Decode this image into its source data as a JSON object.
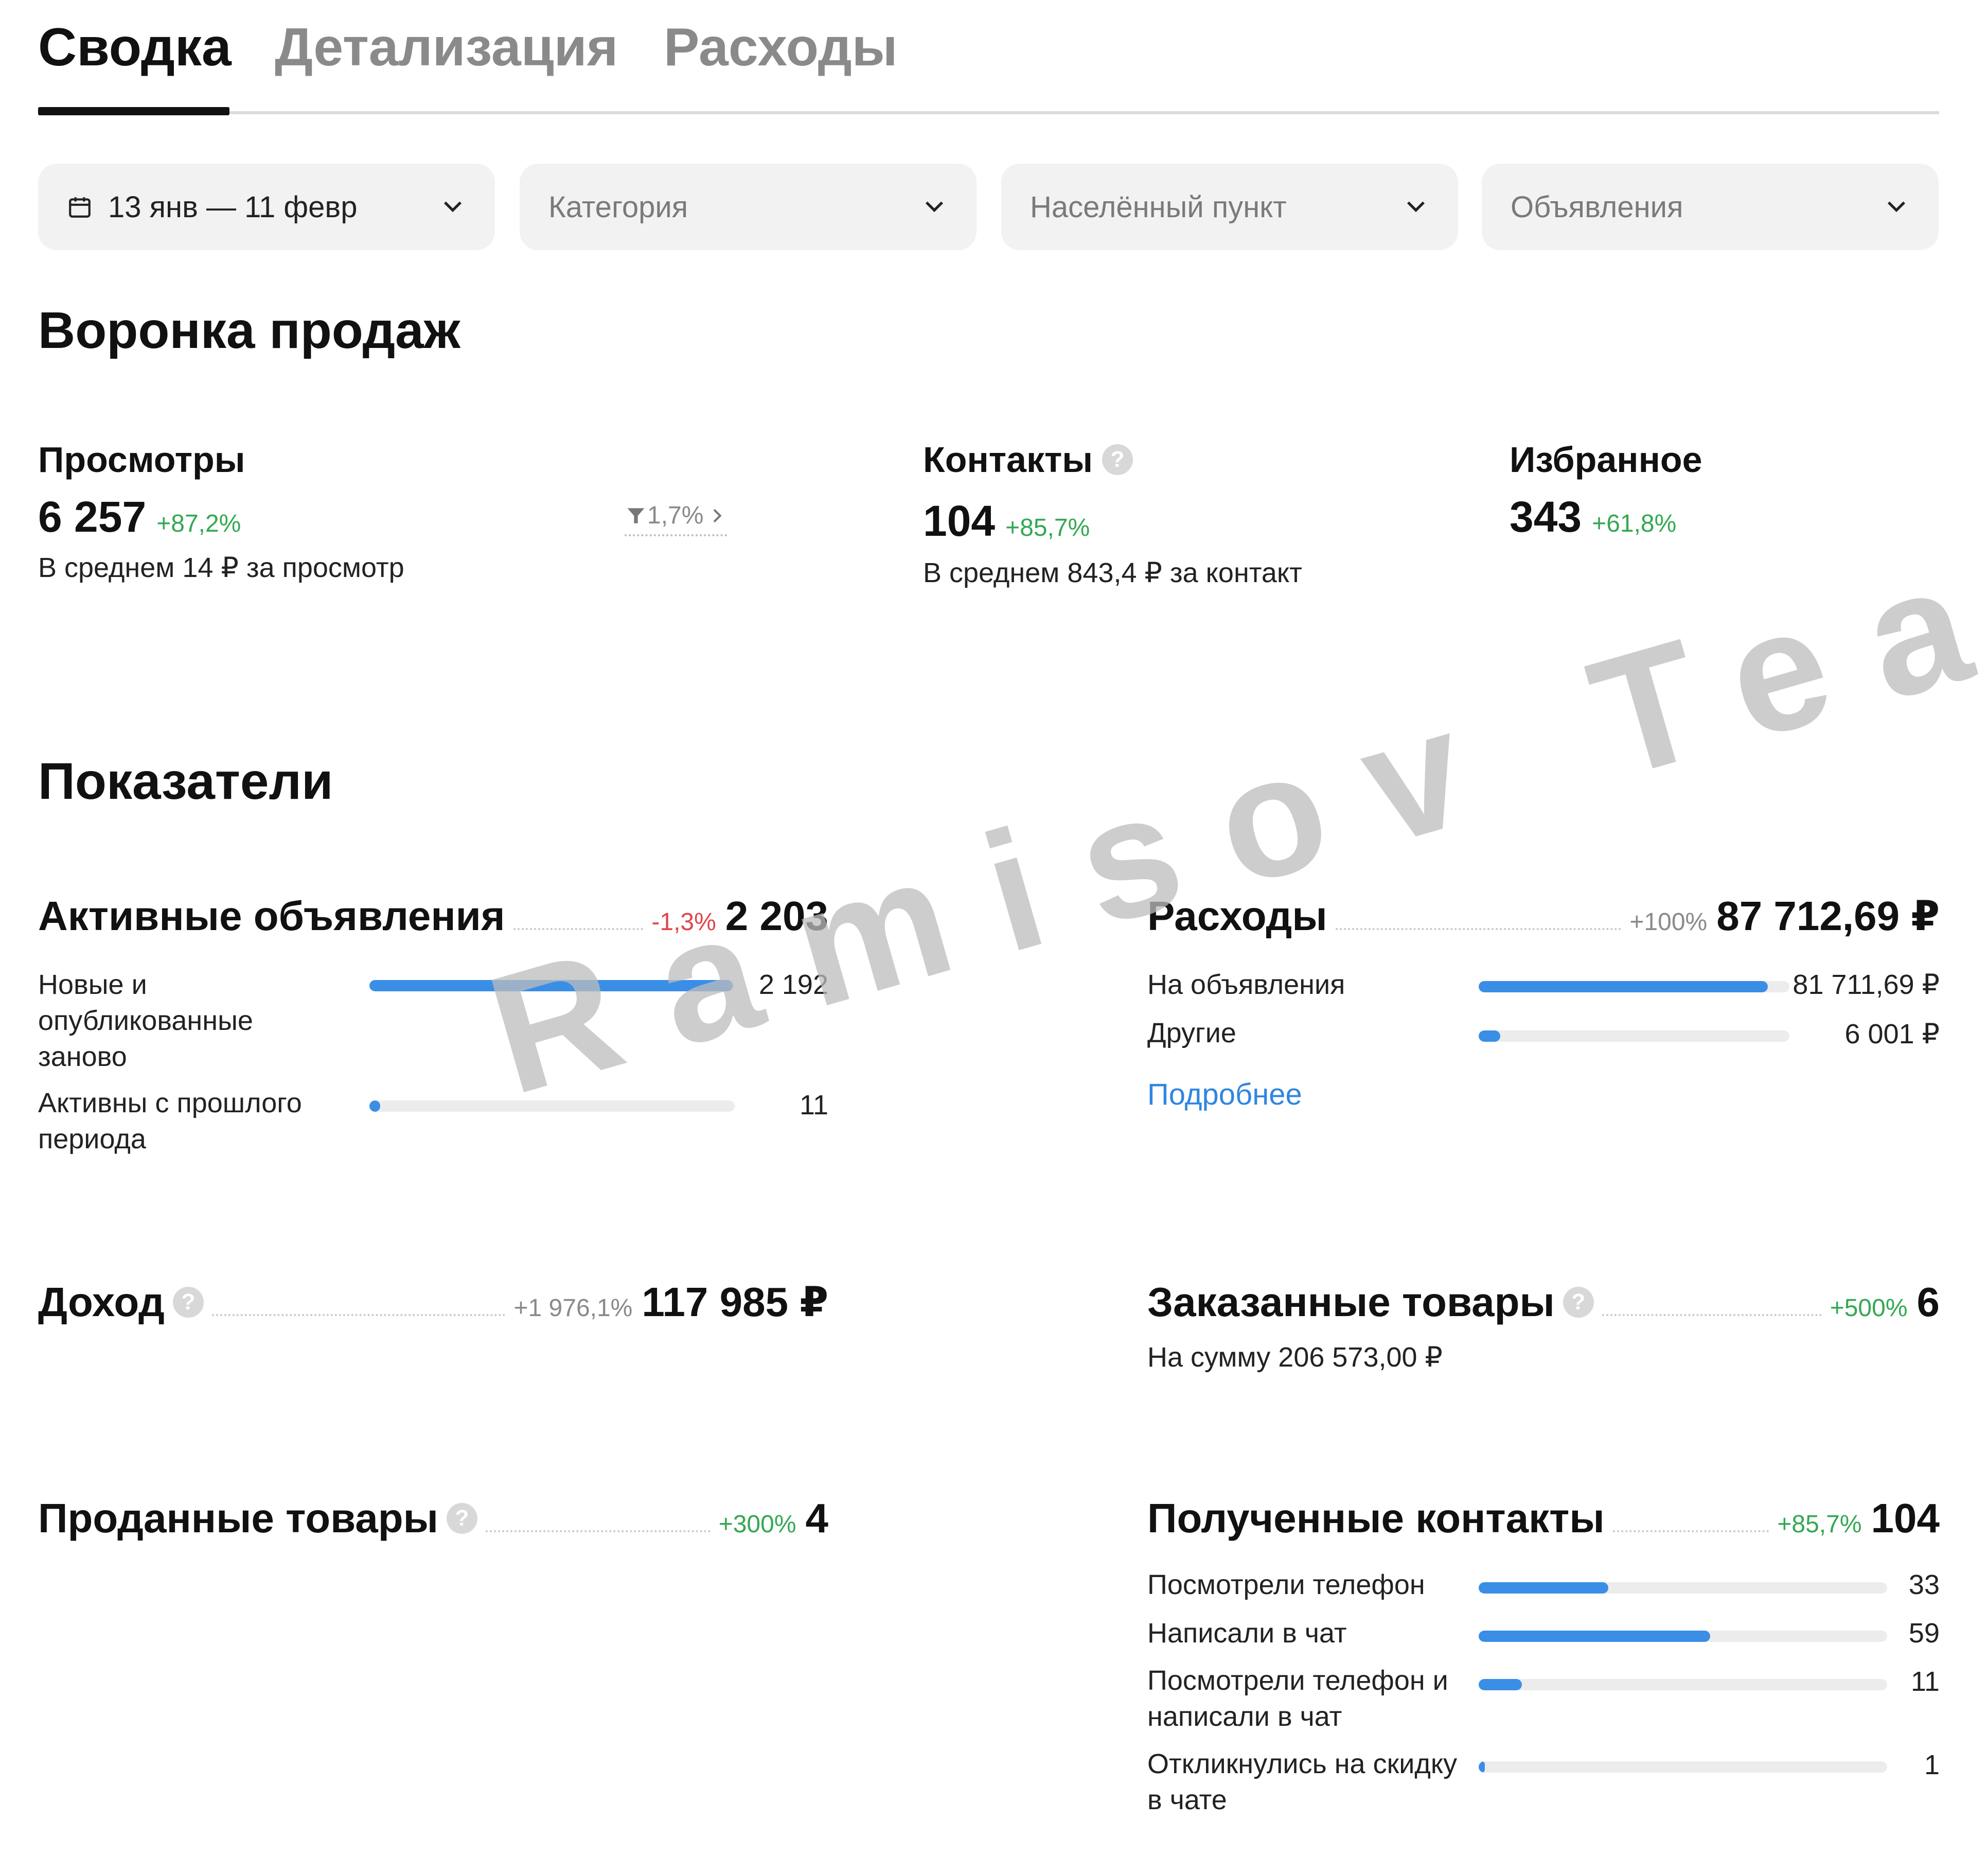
{
  "tabs": [
    {
      "label": "Сводка",
      "active": true
    },
    {
      "label": "Детализация",
      "active": false
    },
    {
      "label": "Расходы",
      "active": false
    }
  ],
  "filters": {
    "date": "13 янв — 11 февр",
    "category": "Категория",
    "location": "Населённый пункт",
    "ads": "Объявления"
  },
  "funnel": {
    "title": "Воронка продаж",
    "views": {
      "label": "Просмотры",
      "value": "6 257",
      "change": "+87,2%",
      "avg": "В среднем 14 ₽ за просмотр",
      "conversion": "1,7%"
    },
    "contacts": {
      "label": "Контакты",
      "value": "104",
      "change": "+85,7%",
      "avg": "В среднем 843,4 ₽ за контакт"
    },
    "favorites": {
      "label": "Избранное",
      "value": "343",
      "change": "+61,8%"
    }
  },
  "metrics": {
    "title": "Показатели",
    "active_ads": {
      "label": "Активные объявления",
      "change": "-1,3%",
      "value": "2 203",
      "rows": [
        {
          "label": "Новые и опубликованные заново",
          "value": "2 192",
          "fraction": 0.995
        },
        {
          "label": "Активны с прошлого периода",
          "value": "11",
          "fraction": 0.03
        }
      ]
    },
    "expenses": {
      "label": "Расходы",
      "change": "+100%",
      "value": "87 712,69 ₽",
      "rows": [
        {
          "label": "На объявления",
          "value": "81 711,69 ₽",
          "fraction": 0.93
        },
        {
          "label": "Другие",
          "value": "6 001 ₽",
          "fraction": 0.07
        }
      ],
      "more_link": "Подробнее"
    },
    "income": {
      "label": "Доход",
      "change": "+1 976,1%",
      "value": "117 985 ₽"
    },
    "ordered": {
      "label": "Заказанные товары",
      "change": "+500%",
      "value": "6",
      "sum": "На сумму 206 573,00 ₽"
    },
    "sold": {
      "label": "Проданные товары",
      "change": "+300%",
      "value": "4"
    },
    "received_contacts": {
      "label": "Полученные контакты",
      "change": "+85,7%",
      "value": "104",
      "rows": [
        {
          "label": "Посмотрели телефон",
          "value": "33",
          "fraction": 0.317
        },
        {
          "label": "Написали в чат",
          "value": "59",
          "fraction": 0.567
        },
        {
          "label": "Посмотрели телефон и написали в чат",
          "value": "11",
          "fraction": 0.106
        },
        {
          "label": "Откликнулись на скидку в чате",
          "value": "1",
          "fraction": 0.01
        }
      ]
    }
  },
  "watermark": "Ramisov Team",
  "colors": {
    "accent_blue": "#3a8ee6",
    "green": "#34a853",
    "red": "#e0454a",
    "track": "#ececec"
  }
}
